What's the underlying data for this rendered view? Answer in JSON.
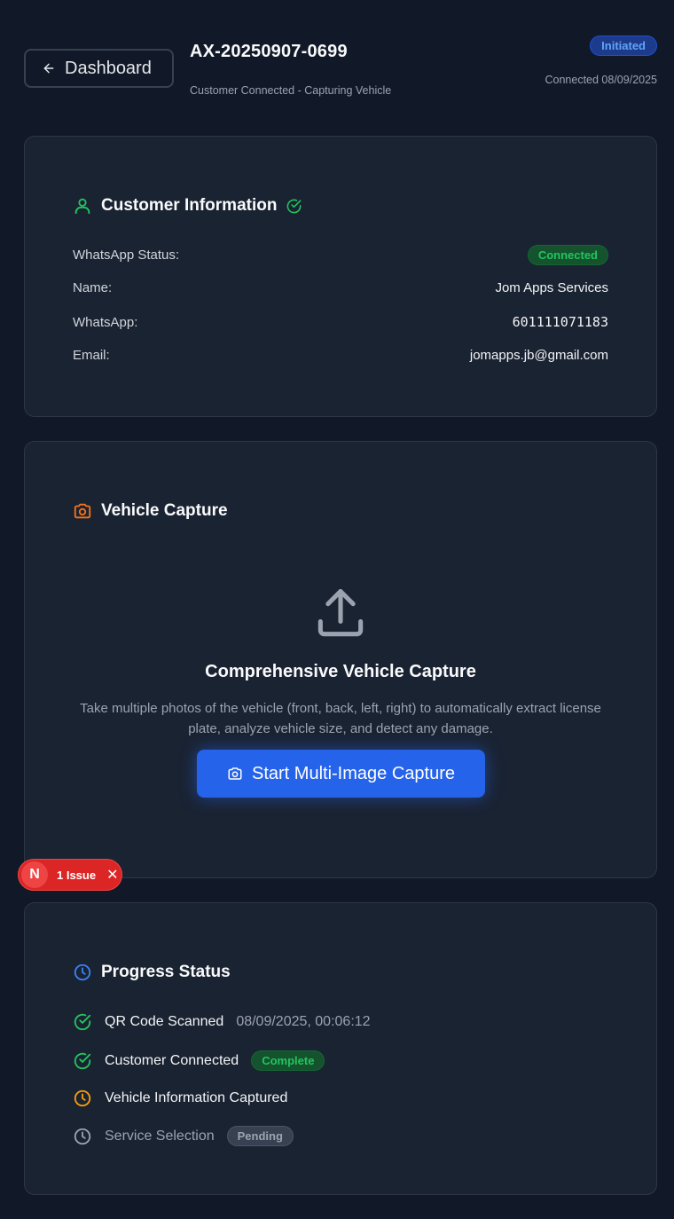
{
  "header": {
    "back_label": "Dashboard",
    "job_id": "AX-20250907-0699",
    "subtitle": "Customer Connected - Capturing Vehicle",
    "status": "Initiated",
    "connected_text": "Connected 08/09/2025"
  },
  "customer": {
    "title": "Customer Information",
    "rows": [
      {
        "label": "WhatsApp Status:",
        "value": "Connected"
      },
      {
        "label": "Name:",
        "value": "Jom Apps Services"
      },
      {
        "label": "WhatsApp:",
        "value": "601111071183"
      },
      {
        "label": "Email:",
        "value": "jomapps.jb@gmail.com"
      }
    ]
  },
  "vehicle": {
    "title": "Vehicle Capture",
    "heading": "Comprehensive Vehicle Capture",
    "description": "Take multiple photos of the vehicle (front, back, left, right) to automatically extract license plate, analyze vehicle size, and detect any damage.",
    "button_label": "Start Multi-Image Capture"
  },
  "issue_badge": {
    "logo": "N",
    "label": "1 Issue",
    "close": "✕"
  },
  "progress": {
    "title": "Progress Status",
    "steps": [
      {
        "label": "QR Code Scanned",
        "detail": "08/09/2025, 00:06:12",
        "state": "done"
      },
      {
        "label": "Customer Connected",
        "badge": "Complete",
        "state": "done"
      },
      {
        "label": "Vehicle Information Captured",
        "state": "in-progress"
      },
      {
        "label": "Service Selection",
        "badge": "Pending",
        "state": "pending"
      }
    ]
  },
  "colors": {
    "background": "#111827",
    "card": "#1a2332",
    "accent_blue": "#2563eb",
    "success_green": "#22c55e",
    "warning_amber": "#f59e0b",
    "orange_icon": "#f97316",
    "issue_red": "#dc2626"
  },
  "icons": {
    "back": "arrow-left-icon",
    "customer": "user-icon",
    "verified": "check-circle-icon",
    "vehicle": "camera-icon",
    "upload": "upload-icon",
    "progress": "clock-icon"
  }
}
